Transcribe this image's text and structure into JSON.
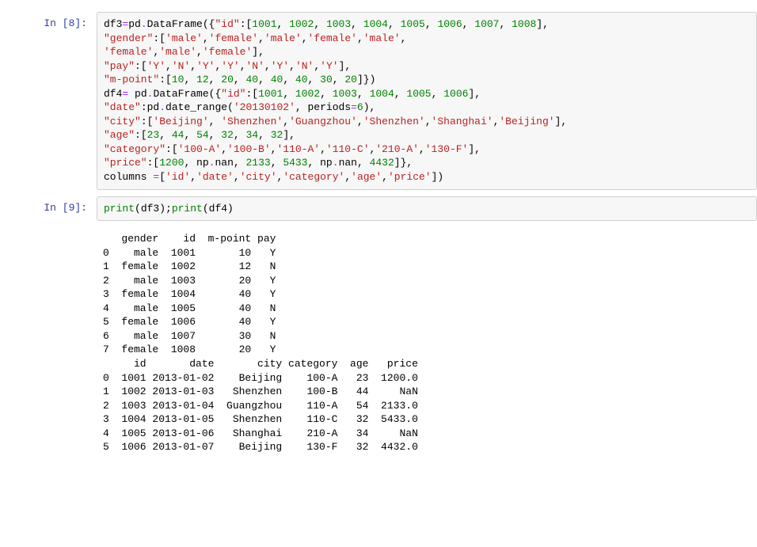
{
  "cells": {
    "c8": {
      "prompt_label": "In ",
      "prompt_num": "[8]:",
      "code": {
        "l1a": "df3",
        "l1b": "=",
        "l1c": "pd",
        "l1d": ".",
        "l1e": "DataFrame",
        "l1f": "({",
        "l1g": "\"id\"",
        "l1h": ":[",
        "l1i": "1001",
        "l1j": ", ",
        "l1k": "1002",
        "l1l": ", ",
        "l1m": "1003",
        "l1n": ", ",
        "l1o": "1004",
        "l1p": ", ",
        "l1q": "1005",
        "l1r": ", ",
        "l1s": "1006",
        "l1t": ", ",
        "l1u": "1007",
        "l1v": ", ",
        "l1w": "1008",
        "l1x": "],",
        "l2a": "\"gender\"",
        "l2b": ":[",
        "l2c": "'male'",
        "l2d": ",",
        "l2e": "'female'",
        "l2f": ",",
        "l2g": "'male'",
        "l2h": ",",
        "l2i": "'female'",
        "l2j": ",",
        "l2k": "'male'",
        "l2l": ",",
        "l3a": "'female'",
        "l3b": ",",
        "l3c": "'male'",
        "l3d": ",",
        "l3e": "'female'",
        "l3f": "],",
        "l4a": "\"pay\"",
        "l4b": ":[",
        "l4c": "'Y'",
        "l4d": ",",
        "l4e": "'N'",
        "l4f": ",",
        "l4g": "'Y'",
        "l4h": ",",
        "l4i": "'Y'",
        "l4j": ",",
        "l4k": "'N'",
        "l4l": ",",
        "l4m": "'Y'",
        "l4n": ",",
        "l4o": "'N'",
        "l4p": ",",
        "l4q": "'Y'",
        "l4r": "],",
        "l5a": "\"m-point\"",
        "l5b": ":[",
        "l5c": "10",
        "l5d": ", ",
        "l5e": "12",
        "l5f": ", ",
        "l5g": "20",
        "l5h": ", ",
        "l5i": "40",
        "l5j": ", ",
        "l5k": "40",
        "l5l": ", ",
        "l5m": "40",
        "l5n": ", ",
        "l5o": "30",
        "l5p": ", ",
        "l5q": "20",
        "l5r": "]})",
        "l6a": "df4",
        "l6b": "= ",
        "l6c": "pd",
        "l6d": ".",
        "l6e": "DataFrame",
        "l6f": "({",
        "l6g": "\"id\"",
        "l6h": ":[",
        "l6i": "1001",
        "l6j": ", ",
        "l6k": "1002",
        "l6l": ", ",
        "l6m": "1003",
        "l6n": ", ",
        "l6o": "1004",
        "l6p": ", ",
        "l6q": "1005",
        "l6r": ", ",
        "l6s": "1006",
        "l6t": "],",
        "l7a": "\"date\"",
        "l7b": ":",
        "l7c": "pd",
        "l7d": ".",
        "l7e": "date_range",
        "l7f": "(",
        "l7g": "'20130102'",
        "l7h": ", periods",
        "l7i": "=",
        "l7j": "6",
        "l7k": "),",
        "l8a": "\"city\"",
        "l8b": ":[",
        "l8c": "'Beijing'",
        "l8d": ", ",
        "l8e": "'Shenzhen'",
        "l8f": ",",
        "l8g": "'Guangzhou'",
        "l8h": ",",
        "l8i": "'Shenzhen'",
        "l8j": ",",
        "l8k": "'Shanghai'",
        "l8l": ",",
        "l8m": "'Beijing'",
        "l8n": "],",
        "l9a": "\"age\"",
        "l9b": ":[",
        "l9c": "23",
        "l9d": ", ",
        "l9e": "44",
        "l9f": ", ",
        "l9g": "54",
        "l9h": ", ",
        "l9i": "32",
        "l9j": ", ",
        "l9k": "34",
        "l9l": ", ",
        "l9m": "32",
        "l9n": "],",
        "l10a": "\"category\"",
        "l10b": ":[",
        "l10c": "'100-A'",
        "l10d": ",",
        "l10e": "'100-B'",
        "l10f": ",",
        "l10g": "'110-A'",
        "l10h": ",",
        "l10i": "'110-C'",
        "l10j": ",",
        "l10k": "'210-A'",
        "l10l": ",",
        "l10m": "'130-F'",
        "l10n": "],",
        "l11a": "\"price\"",
        "l11b": ":[",
        "l11c": "1200",
        "l11d": ", np",
        "l11e": ".",
        "l11f": "nan, ",
        "l11g": "2133",
        "l11h": ", ",
        "l11i": "5433",
        "l11j": ", np",
        "l11k": ".",
        "l11l": "nan, ",
        "l11m": "4432",
        "l11n": "]},",
        "l12a": "columns ",
        "l12b": "=",
        "l12c": "[",
        "l12d": "'id'",
        "l12e": ",",
        "l12f": "'date'",
        "l12g": ",",
        "l12h": "'city'",
        "l12i": ",",
        "l12j": "'category'",
        "l12k": ",",
        "l12l": "'age'",
        "l12m": ",",
        "l12n": "'price'",
        "l12o": "])"
      }
    },
    "c9": {
      "prompt_label": "In ",
      "prompt_num": "[9]:",
      "code": {
        "p1": "print",
        "p2": "(df3);",
        "p3": "print",
        "p4": "(df4)"
      },
      "output": "   gender    id  m-point pay\n0    male  1001       10   Y\n1  female  1002       12   N\n2    male  1003       20   Y\n3  female  1004       40   Y\n4    male  1005       40   N\n5  female  1006       40   Y\n6    male  1007       30   N\n7  female  1008       20   Y\n     id       date       city category  age   price\n0  1001 2013-01-02    Beijing    100-A   23  1200.0\n1  1002 2013-01-03   Shenzhen    100-B   44     NaN\n2  1003 2013-01-04  Guangzhou    110-A   54  2133.0\n3  1004 2013-01-05   Shenzhen    110-C   32  5433.0\n4  1005 2013-01-06   Shanghai    210-A   34     NaN\n5  1006 2013-01-07    Beijing    130-F   32  4432.0"
    }
  }
}
